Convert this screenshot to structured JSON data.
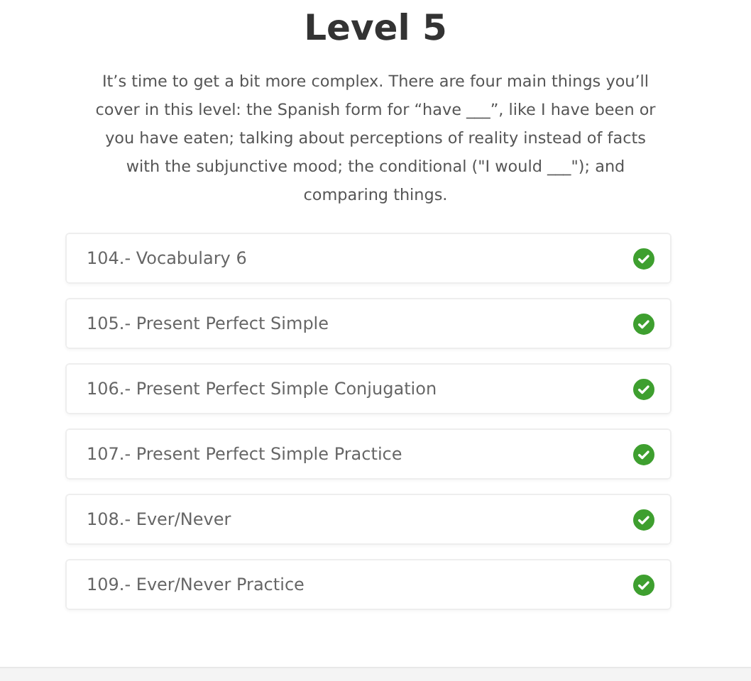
{
  "title": "Level 5",
  "description": "It’s time to get a bit more complex. There are four main things you’ll cover in this level: the Spanish form for “have ___”, like I have been or you have eaten; talking about perceptions of reality instead of facts with the subjunctive mood; the conditional (\"I would ___\"); and comparing things.",
  "lessons": [
    {
      "label": "104.- Vocabulary 6",
      "completed": true
    },
    {
      "label": "105.- Present Perfect Simple",
      "completed": true
    },
    {
      "label": "106.- Present Perfect Simple Conjugation",
      "completed": true
    },
    {
      "label": "107.- Present Perfect Simple Practice",
      "completed": true
    },
    {
      "label": "108.- Ever/Never",
      "completed": true
    },
    {
      "label": "109.- Ever/Never Practice",
      "completed": true
    }
  ]
}
